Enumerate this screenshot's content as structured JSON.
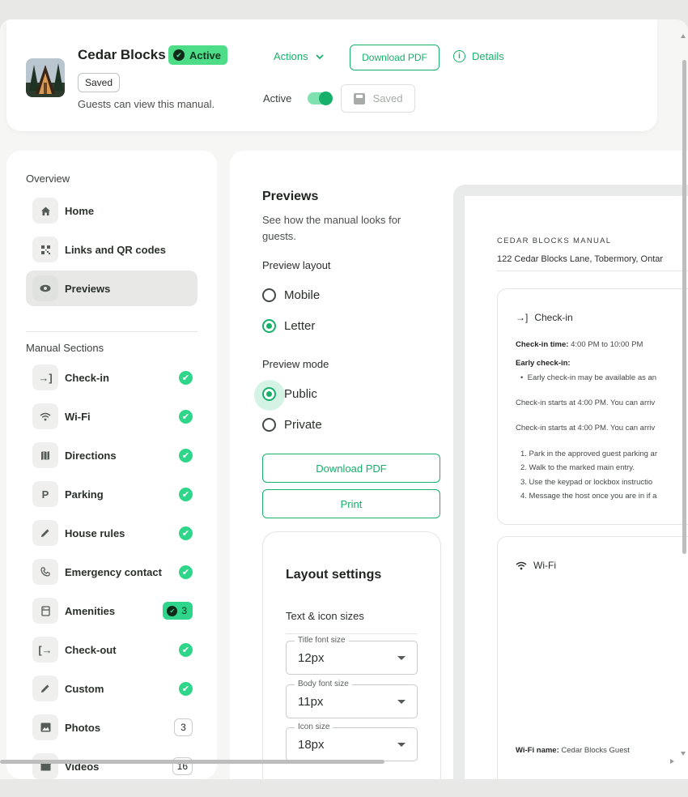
{
  "header": {
    "title": "Cedar Blocks",
    "status_badge": "Active",
    "saved_chip": "Saved",
    "visibility_text": "Guests can view this manual.",
    "actions_label": "Actions",
    "download_pdf_label": "Download PDF",
    "details_label": "Details",
    "active_toggle_label": "Active",
    "active_toggle_on": true,
    "saved_button_label": "Saved"
  },
  "sidebar": {
    "overview_label": "Overview",
    "overview_items": [
      {
        "label": "Home",
        "icon": "home-icon"
      },
      {
        "label": "Links and QR codes",
        "icon": "qr-code-icon"
      },
      {
        "label": "Previews",
        "icon": "eye-icon",
        "selected": true
      }
    ],
    "manual_label": "Manual Sections",
    "manual_items": [
      {
        "label": "Check-in",
        "icon": "login-icon",
        "status": "check"
      },
      {
        "label": "Wi-Fi",
        "icon": "wifi-icon",
        "status": "check"
      },
      {
        "label": "Directions",
        "icon": "map-icon",
        "status": "check"
      },
      {
        "label": "Parking",
        "icon": "parking-icon",
        "status": "check"
      },
      {
        "label": "House rules",
        "icon": "pencil-icon",
        "status": "check"
      },
      {
        "label": "Emergency contact",
        "icon": "phone-icon",
        "status": "check"
      },
      {
        "label": "Amenities",
        "icon": "amenities-icon",
        "status": "count-green",
        "count": "3"
      },
      {
        "label": "Check-out",
        "icon": "logout-icon",
        "status": "check"
      },
      {
        "label": "Custom",
        "icon": "pencil-icon",
        "status": "check"
      },
      {
        "label": "Photos",
        "icon": "image-icon",
        "status": "count",
        "count": "3"
      },
      {
        "label": "Videos",
        "icon": "video-icon",
        "status": "count",
        "count": "16"
      }
    ]
  },
  "main": {
    "title": "Previews",
    "description": "See how the manual looks for guests.",
    "layout_label": "Preview layout",
    "layout_options": [
      "Mobile",
      "Letter"
    ],
    "layout_selected": "Letter",
    "mode_label": "Preview mode",
    "mode_options": [
      "Public",
      "Private"
    ],
    "mode_selected": "Public",
    "download_pdf_label": "Download PDF",
    "print_label": "Print",
    "layout_settings": {
      "title": "Layout settings",
      "subtitle": "Text & icon sizes",
      "fields": [
        {
          "label": "Title font size",
          "value": "12px"
        },
        {
          "label": "Body font size",
          "value": "11px"
        },
        {
          "label": "Icon size",
          "value": "18px"
        }
      ]
    }
  },
  "preview": {
    "kicker": "CEDAR BLOCKS MANUAL",
    "address": "122 Cedar Blocks Lane, Tobermory, Ontar",
    "checkin": {
      "title": "Check-in",
      "time_label": "Check-in time:",
      "time_value": "4:00 PM to 10:00 PM",
      "early_label": "Early check-in:",
      "early_bullet": "Early check-in may be available as an",
      "para1": "Check-in starts at 4:00 PM. You can arriv",
      "para2": "Check-in starts at 4:00 PM. You can arriv",
      "steps": [
        "1. Park in the approved guest parking ar",
        "2. Walk to the marked main entry.",
        "3. Use the keypad or lockbox instructio",
        "4. Message the host once you are in if a"
      ]
    },
    "wifi": {
      "title": "Wi-Fi",
      "name_label": "Wi-Fi name:",
      "name_value": "Cedar Blocks Guest"
    }
  },
  "colors": {
    "accent": "#17b06b",
    "badge_green": "#4ddc88",
    "check_green": "#2fd58a"
  }
}
